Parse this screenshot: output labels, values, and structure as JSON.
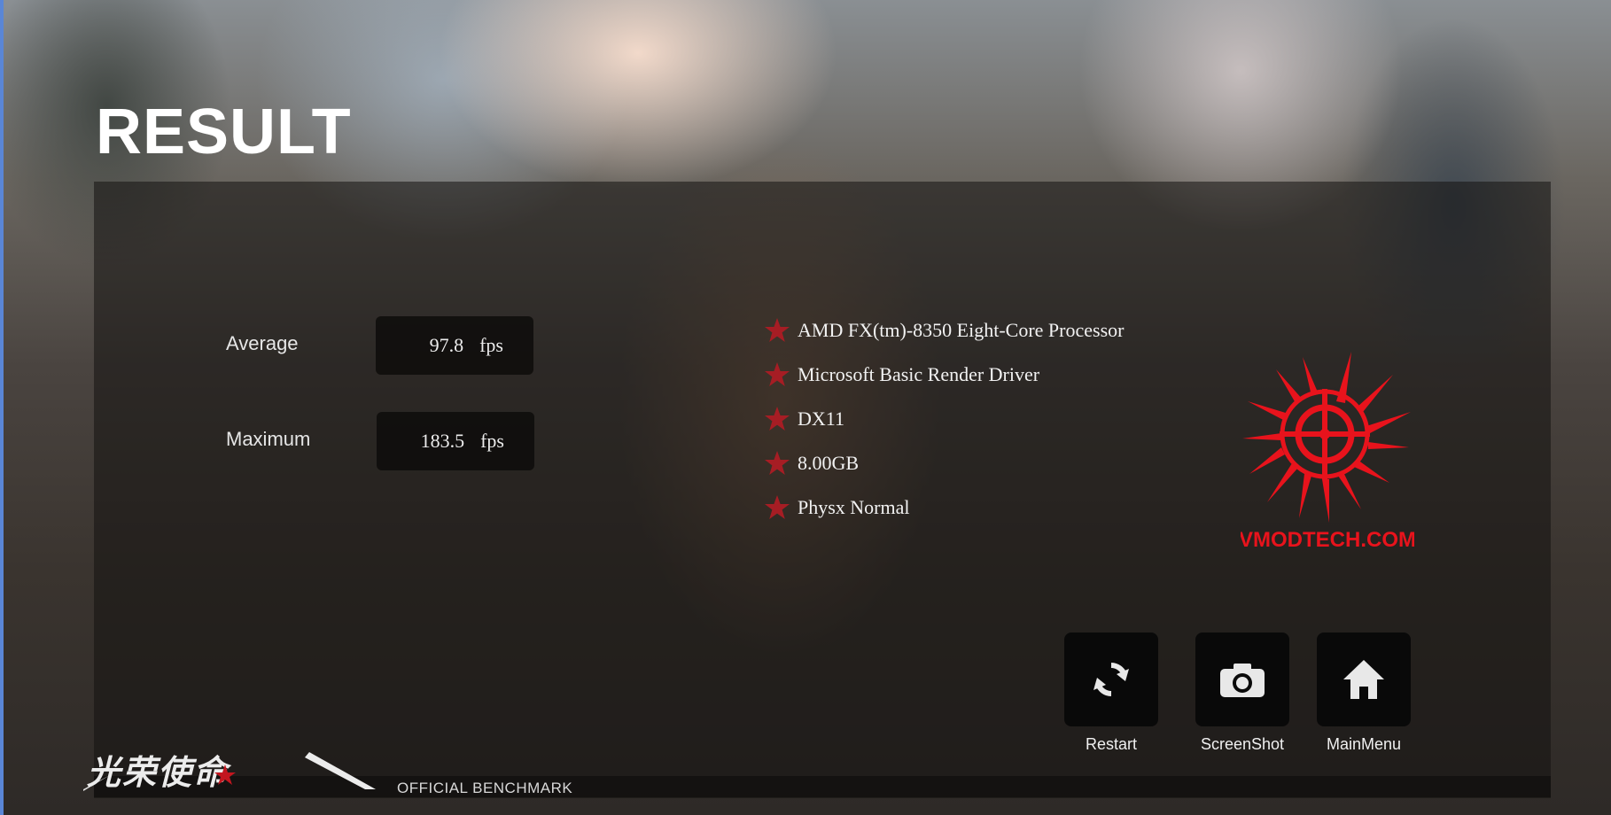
{
  "header": {
    "title": "RESULT"
  },
  "stats": [
    {
      "label": "Average",
      "value": "97.8",
      "unit": "fps"
    },
    {
      "label": "Maximum",
      "value": "183.5",
      "unit": "fps"
    }
  ],
  "specs": [
    "AMD FX(tm)-8350 Eight-Core Processor",
    "Microsoft Basic Render Driver",
    "DX11",
    "8.00GB",
    "Physx Normal"
  ],
  "watermark": {
    "text": "VMODTECH.COM",
    "color": "#e8131c"
  },
  "actions": {
    "restart": {
      "label": "Restart",
      "icon": "refresh-icon"
    },
    "screenshot": {
      "label": "ScreenShot",
      "icon": "camera-icon"
    },
    "mainmenu": {
      "label": "MainMenu",
      "icon": "home-icon"
    }
  },
  "footer": {
    "brand": "光荣使命",
    "subtitle": "OFFICIAL BENCHMARK"
  },
  "colors": {
    "accent_star": "#a61d24",
    "panel": "#141211"
  }
}
